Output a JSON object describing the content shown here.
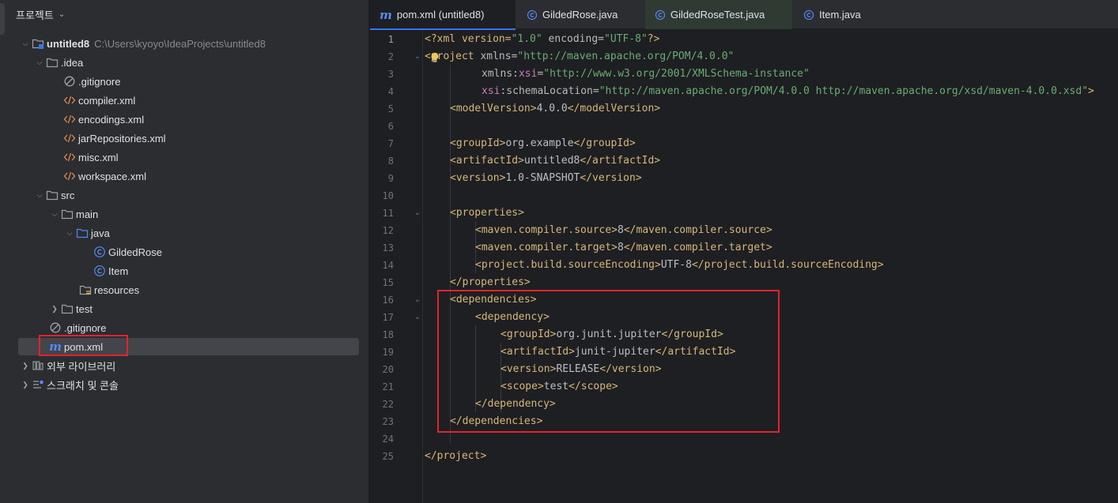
{
  "project_panel": {
    "header": "프로젝트",
    "tree": [
      {
        "label": "untitled8",
        "hint": "C:\\Users\\kyoyo\\IdeaProjects\\untitled8",
        "icon": "module-folder-icon",
        "expanded": true
      },
      {
        "label": ".idea",
        "icon": "folder-icon",
        "expanded": true
      },
      {
        "label": ".gitignore",
        "icon": "ignore-file-icon"
      },
      {
        "label": "compiler.xml",
        "icon": "xml-file-icon"
      },
      {
        "label": "encodings.xml",
        "icon": "xml-file-icon"
      },
      {
        "label": "jarRepositories.xml",
        "icon": "xml-file-icon"
      },
      {
        "label": "misc.xml",
        "icon": "xml-file-icon"
      },
      {
        "label": "workspace.xml",
        "icon": "xml-file-icon"
      },
      {
        "label": "src",
        "icon": "folder-icon",
        "expanded": true
      },
      {
        "label": "main",
        "icon": "folder-icon",
        "expanded": true
      },
      {
        "label": "java",
        "icon": "source-folder-icon",
        "expanded": true
      },
      {
        "label": "GildedRose",
        "icon": "java-class-icon"
      },
      {
        "label": "Item",
        "icon": "java-class-icon"
      },
      {
        "label": "resources",
        "icon": "resources-folder-icon"
      },
      {
        "label": "test",
        "icon": "folder-icon",
        "expanded": false
      },
      {
        "label": ".gitignore",
        "icon": "ignore-file-icon"
      },
      {
        "label": "pom.xml",
        "icon": "maven-file-icon",
        "selected": true
      },
      {
        "label": "외부 라이브러리",
        "icon": "library-icon",
        "expanded": false
      },
      {
        "label": "스크래치 및 콘솔",
        "icon": "scratches-icon",
        "expanded": false
      }
    ]
  },
  "editor": {
    "tabs": [
      {
        "label": "pom.xml (untitled8)",
        "icon": "maven-file-icon",
        "active": true
      },
      {
        "label": "GildedRose.java",
        "icon": "java-class-icon"
      },
      {
        "label": "GildedRoseTest.java",
        "icon": "java-class-icon"
      },
      {
        "label": "Item.java",
        "icon": "java-class-icon"
      }
    ],
    "line_numbers": [
      "1",
      "2",
      "3",
      "4",
      "5",
      "6",
      "7",
      "8",
      "9",
      "10",
      "11",
      "12",
      "13",
      "14",
      "15",
      "16",
      "17",
      "18",
      "19",
      "20",
      "21",
      "22",
      "23",
      "24",
      "25"
    ],
    "code": {
      "l1": {
        "open": "<?xml version=",
        "v1": "\"1.0\"",
        "mid": " encoding=",
        "v2": "\"UTF-8\"",
        "close": "?>"
      },
      "l2": {
        "tag": "<project ",
        "attr": "xmlns=",
        "val": "\"http://maven.apache.org/POM/4.0.0\""
      },
      "l3": {
        "attr": "xmlns:",
        "ns": "xsi",
        "eq": "=",
        "val": "\"http://www.w3.org/2001/XMLSchema-instance\""
      },
      "l4": {
        "ns": "xsi",
        "attr": ":schemaLocation=",
        "val": "\"http://maven.apache.org/POM/4.0.0 http://maven.apache.org/xsd/maven-4.0.0.xsd\"",
        "close": ">"
      },
      "l5": {
        "open": "<modelVersion>",
        "text": "4.0.0",
        "close": "</modelVersion>"
      },
      "l7": {
        "open": "<groupId>",
        "text": "org.example",
        "close": "</groupId>"
      },
      "l8": {
        "open": "<artifactId>",
        "text": "untitled8",
        "close": "</artifactId>"
      },
      "l9": {
        "open": "<version>",
        "text": "1.0-SNAPSHOT",
        "close": "</version>"
      },
      "l11": {
        "open": "<properties>"
      },
      "l12": {
        "open": "<maven.compiler.source>",
        "text": "8",
        "close": "</maven.compiler.source>"
      },
      "l13": {
        "open": "<maven.compiler.target>",
        "text": "8",
        "close": "</maven.compiler.target>"
      },
      "l14": {
        "open": "<project.build.sourceEncoding>",
        "text": "UTF-8",
        "close": "</project.build.sourceEncoding>"
      },
      "l15": {
        "close": "</properties>"
      },
      "l16": {
        "open": "<dependencies>"
      },
      "l17": {
        "open": "<dependency>"
      },
      "l18": {
        "open": "<groupId>",
        "text": "org.junit.jupiter",
        "close": "</groupId>"
      },
      "l19": {
        "open": "<artifactId>",
        "text": "junit-jupiter",
        "close": "</artifactId>"
      },
      "l20": {
        "open": "<version>",
        "text": "RELEASE",
        "close": "</version>"
      },
      "l21": {
        "open": "<scope>",
        "text": "test",
        "close": "</scope>"
      },
      "l22": {
        "close": "</dependency>"
      },
      "l23": {
        "close": "</dependencies>"
      },
      "l25": {
        "close": "</project>"
      }
    }
  },
  "colors": {
    "accent": "#3574f0",
    "highlight_box": "#e0242b",
    "xml_tag": "#d5b778",
    "xml_value": "#6aab73",
    "xml_namespace": "#c77dbb"
  }
}
